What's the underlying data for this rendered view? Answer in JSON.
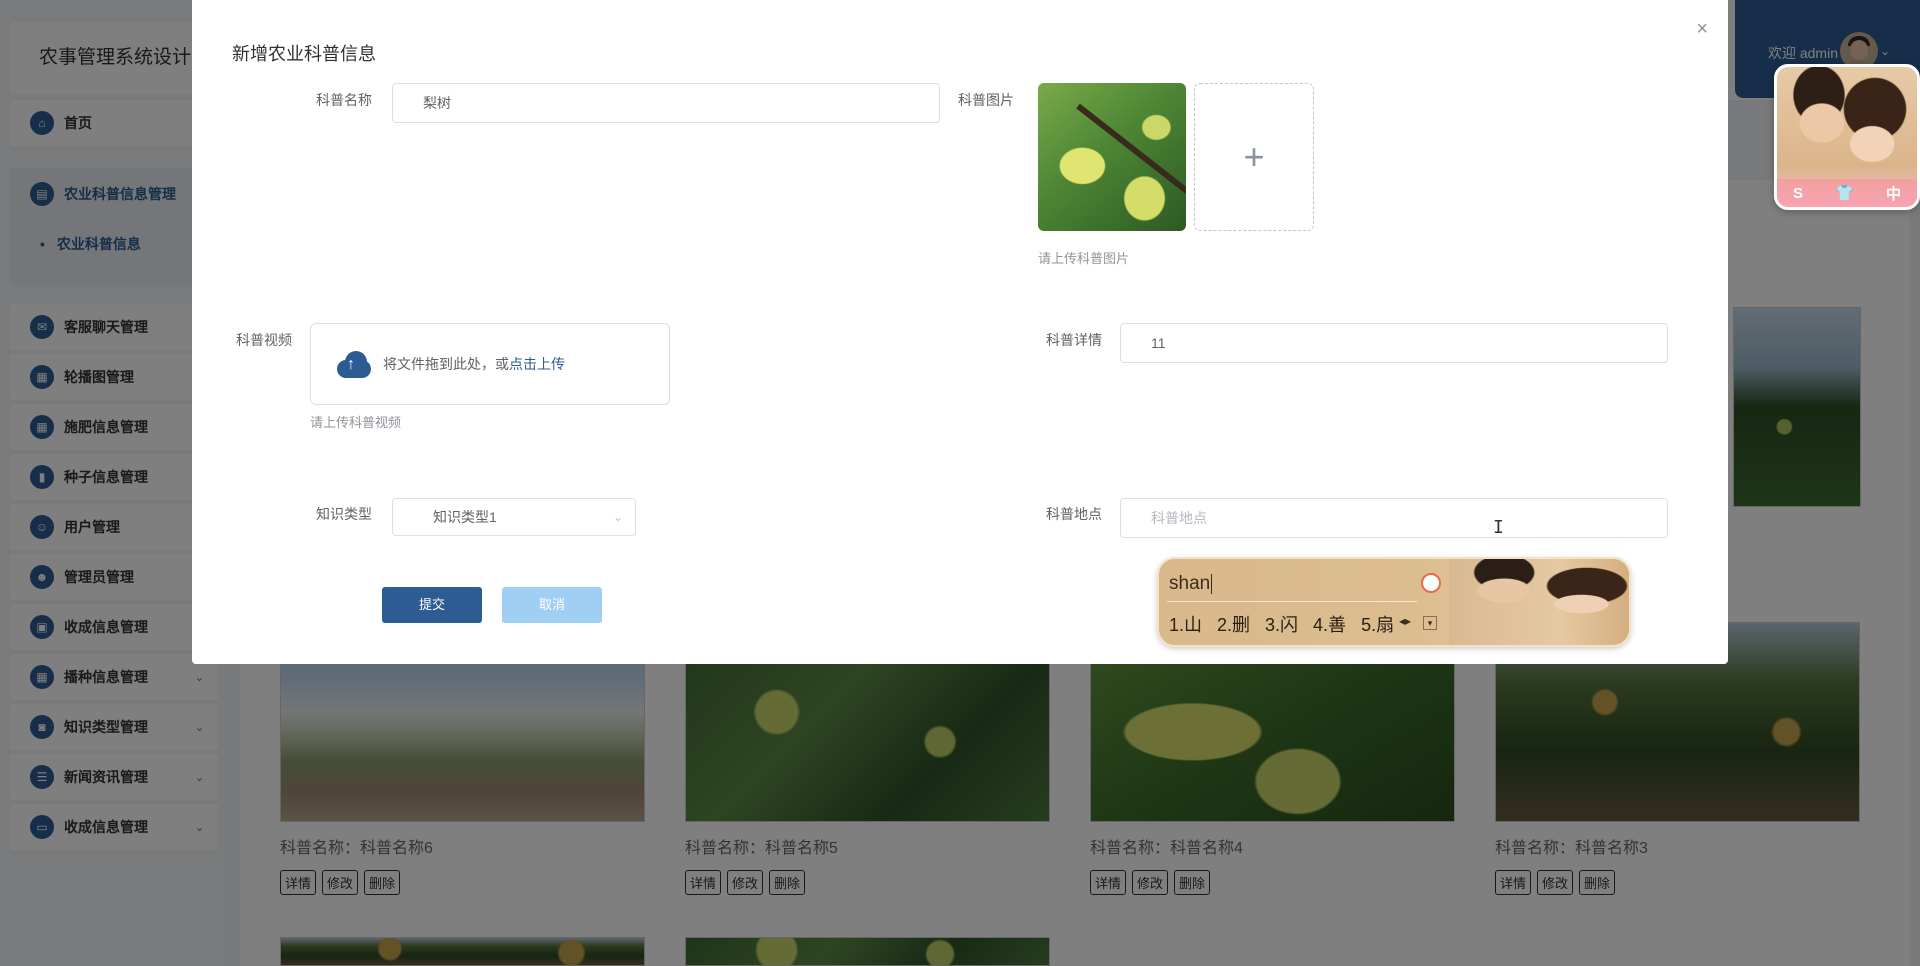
{
  "app": {
    "title": "农事管理系统设计",
    "welcome": "欢迎 admin"
  },
  "sidebar": {
    "home": "首页",
    "open_group": "农业科普信息管理",
    "open_sub": "农业科普信息",
    "items": [
      {
        "label": "客服聊天管理"
      },
      {
        "label": "轮播图管理"
      },
      {
        "label": "施肥信息管理"
      },
      {
        "label": "种子信息管理"
      },
      {
        "label": "用户管理"
      },
      {
        "label": "管理员管理"
      },
      {
        "label": "收成信息管理"
      },
      {
        "label": "播种信息管理"
      },
      {
        "label": "知识类型管理"
      },
      {
        "label": "新闻资讯管理"
      },
      {
        "label": "收成信息管理"
      }
    ]
  },
  "cards": [
    {
      "name": "科普名称：科普名称6"
    },
    {
      "name": "科普名称：科普名称5"
    },
    {
      "name": "科普名称：科普名称4"
    },
    {
      "name": "科普名称：科普名称3"
    }
  ],
  "card_ops": {
    "detail": "详情",
    "edit": "修改",
    "delete": "删除"
  },
  "dialog": {
    "title": "新增农业科普信息",
    "close": "×",
    "name_label": "科普名称",
    "name_value": "梨树",
    "image_label": "科普图片",
    "image_hint": "请上传科普图片",
    "add_icon": "+",
    "video_label": "科普视频",
    "video_drop_text": "将文件拖到此处，或",
    "video_drop_link": "点击上传",
    "video_hint": "请上传科普视频",
    "detail_label": "科普详情",
    "detail_value": "11",
    "type_label": "知识类型",
    "type_value": "知识类型1",
    "place_label": "科普地点",
    "place_placeholder": "科普地点",
    "submit": "提交",
    "cancel": "取消"
  },
  "ime": {
    "pinyin": "shan",
    "candidates": [
      "1.山",
      "2.删",
      "3.闪",
      "4.善",
      "5.扇"
    ],
    "nav": "◂▸",
    "more": "▾"
  },
  "skin_widget": {
    "buttons": [
      "S",
      "👕",
      "中"
    ]
  }
}
